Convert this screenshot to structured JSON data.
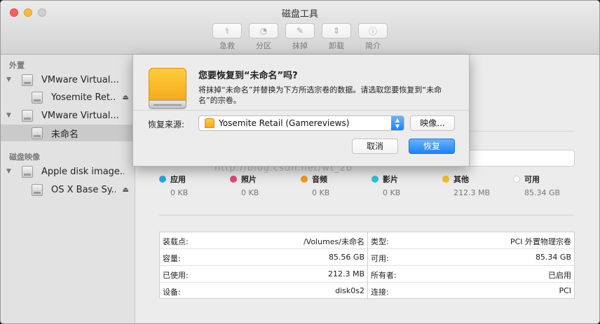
{
  "window": {
    "title": "磁盘工具"
  },
  "toolbar": [
    {
      "label": "急救",
      "icon": "first-aid-icon"
    },
    {
      "label": "分区",
      "icon": "partition-icon"
    },
    {
      "label": "抹掉",
      "icon": "erase-icon"
    },
    {
      "label": "卸载",
      "icon": "unmount-icon"
    },
    {
      "label": "简介",
      "icon": "info-icon"
    }
  ],
  "sidebar": {
    "sections": [
      {
        "header": "外置"
      },
      {
        "header": "磁盘映像"
      }
    ],
    "items": [
      {
        "label": "VMware Virtual..."
      },
      {
        "label": "Yosemite Ret..."
      },
      {
        "label": "VMware Virtual..."
      },
      {
        "label": "未命名"
      },
      {
        "label": "Apple disk image..."
      },
      {
        "label": "OS X Base Sy..."
      }
    ]
  },
  "usage": {
    "categories": [
      {
        "name": "应用",
        "size": "0 KB",
        "color": "#2aa7e6"
      },
      {
        "name": "照片",
        "size": "0 KB",
        "color": "#e8477a"
      },
      {
        "name": "音频",
        "size": "0 KB",
        "color": "#f59a1b"
      },
      {
        "name": "影片",
        "size": "0 KB",
        "color": "#31c3d6"
      },
      {
        "name": "其他",
        "size": "212.3 MB",
        "color": "#f3c31a"
      },
      {
        "name": "可用",
        "size": "85.34 GB",
        "color": "#ffffff"
      }
    ]
  },
  "info": {
    "left": [
      {
        "k": "装载点:",
        "v": "/Volumes/未命名"
      },
      {
        "k": "容量:",
        "v": "85.56 GB"
      },
      {
        "k": "已使用:",
        "v": "212.3 MB"
      },
      {
        "k": "设备:",
        "v": "disk0s2"
      }
    ],
    "right": [
      {
        "k": "类型:",
        "v": "PCI 外置物理宗卷"
      },
      {
        "k": "可用:",
        "v": "85.34 GB"
      },
      {
        "k": "所有者:",
        "v": "已启用"
      },
      {
        "k": "连接:",
        "v": "PCI"
      }
    ]
  },
  "sheet": {
    "question": "您要恢复到“未命名”吗?",
    "description": "将抹掉“未命名”并替换为下方所选宗卷的数据。请选取您要恢复到“未命名”的宗卷。",
    "source_label": "恢复来源:",
    "source_value": "Yosemite Retail (Gamereviews)",
    "image_button": "映像...",
    "cancel_button": "取消",
    "restore_button": "恢复"
  },
  "watermark": "http://blog.csdn.net/wt_2b"
}
